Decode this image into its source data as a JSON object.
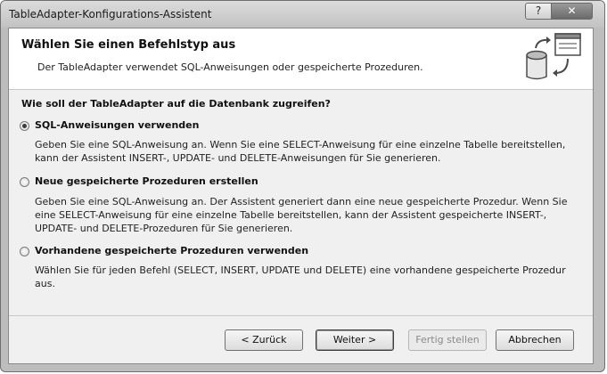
{
  "window": {
    "title": "TableAdapter-Konfigurations-Assistent",
    "help_label": "?",
    "close_label": "✕"
  },
  "header": {
    "title": "Wählen Sie einen Befehlstyp aus",
    "subtitle": "Der TableAdapter verwendet SQL-Anweisungen oder gespeicherte Prozeduren.",
    "icon": "database-sync-icon"
  },
  "question": "Wie soll der TableAdapter auf die Datenbank zugreifen?",
  "options": [
    {
      "label": "SQL-Anweisungen verwenden",
      "selected": true,
      "description": "Geben Sie eine SQL-Anweisung an. Wenn Sie eine SELECT-Anweisung für eine einzelne Tabelle bereitstellen, kann der Assistent INSERT-, UPDATE- und DELETE-Anweisungen für Sie generieren."
    },
    {
      "label": "Neue gespeicherte Prozeduren erstellen",
      "selected": false,
      "description": "Geben Sie eine SQL-Anweisung an. Der Assistent generiert dann eine neue gespeicherte Prozedur. Wenn Sie eine SELECT-Anweisung für eine einzelne Tabelle bereitstellen, kann der Assistent gespeicherte INSERT-, UPDATE- und DELETE-Prozeduren für Sie generieren."
    },
    {
      "label": "Vorhandene gespeicherte Prozeduren verwenden",
      "selected": false,
      "description": "Wählen Sie für jeden Befehl (SELECT, INSERT, UPDATE und DELETE) eine vorhandene gespeicherte Prozedur aus."
    }
  ],
  "buttons": {
    "back": "< Zurück",
    "next": "Weiter >",
    "finish": "Fertig stellen",
    "cancel": "Abbrechen"
  }
}
